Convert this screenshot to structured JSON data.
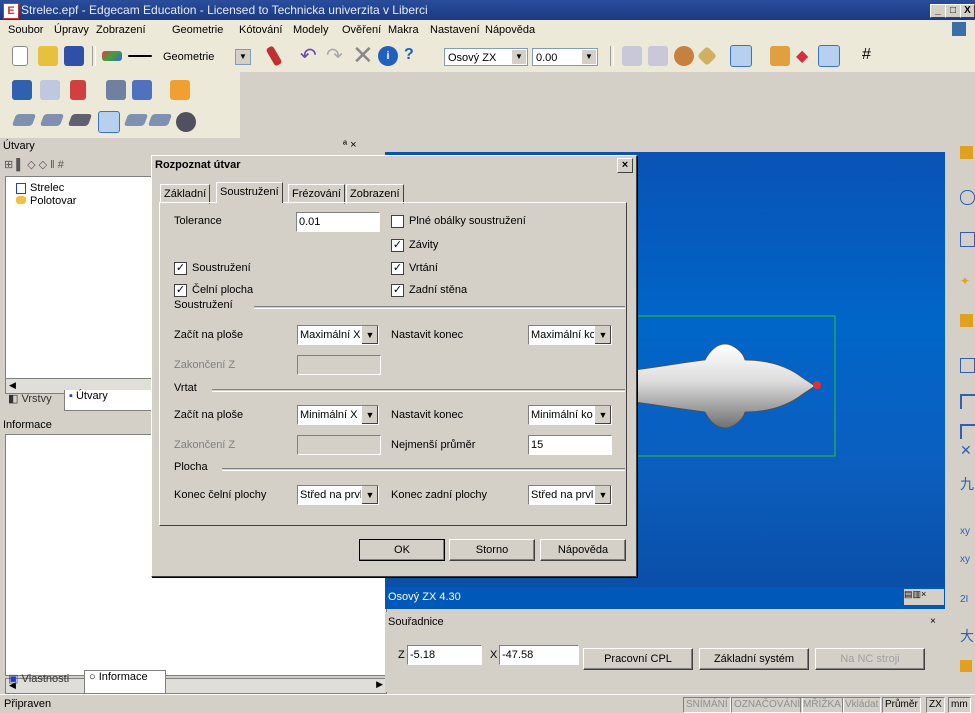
{
  "window": {
    "title": "Strelec.epf - Edgecam Education - Licensed to Technicka univerzita v Liberci",
    "icon_letter": "E",
    "min": "_",
    "restore": "□",
    "close": "X"
  },
  "menu": [
    "Soubor",
    "Úpravy",
    "Zobrazení",
    "Geometrie",
    "Kótování",
    "Modely",
    "Ověření",
    "Makra",
    "Nastavení",
    "Nápověda"
  ],
  "toolbar": {
    "geometry_label": "Geometrie",
    "cpl_value": "Osový ZX",
    "depth_value": "0.00"
  },
  "left_panel": {
    "title": "Útvary",
    "pin": "ª ×",
    "tree": [
      "Strelec",
      "Polotovar"
    ],
    "tabs": [
      "Vrstvy",
      "Útvary"
    ]
  },
  "info_panel": {
    "title": "Informace",
    "tabs": [
      "Vlastnosti",
      "Informace"
    ]
  },
  "viewport": {
    "footer_label": "Osový ZX 4.30"
  },
  "coords": {
    "title": "Souřadnice",
    "z_label": "Z",
    "z_value": "-5.18",
    "x_label": "X",
    "x_value": "-47.58",
    "btn_cpl": "Pracovní CPL",
    "btn_base": "Základní systém",
    "btn_nc": "Na NC stroji"
  },
  "dialog": {
    "title": "Rozpoznat útvar",
    "close": "×",
    "tabs": [
      "Základní",
      "Soustružení",
      "Frézování",
      "Zobrazení"
    ],
    "tolerance_label": "Tolerance",
    "tolerance_value": "0.01",
    "checks": {
      "plne": "Plné obálky soustružení",
      "zavity": "Závity",
      "soustruzeni": "Soustružení",
      "vrtani": "Vrtání",
      "celni": "Čelní plocha",
      "zadni": "Zadní stěna"
    },
    "group_soustruzeni": "Soustružení",
    "group_vrtat": "Vrtat",
    "group_plocha": "Plocha",
    "zacit_label": "Začít na ploše",
    "nastavit_label": "Nastavit konec",
    "zakonceni_label": "Zakončení Z",
    "nejmensi_label": "Nejmenší průměr",
    "nejmensi_value": "15",
    "konec_celni_label": "Konec čelní plochy",
    "konec_zadni_label": "Konec zadní plochy",
    "sel_s_zacit": "Maximální X",
    "sel_s_konec": "Maximální ko",
    "sel_v_zacit": "Minimální X",
    "sel_v_konec": "Minimální ko",
    "sel_p_celni": "Střed na prvl",
    "sel_p_zadni": "Střed na prvl",
    "ok": "OK",
    "storno": "Storno",
    "help": "Nápověda"
  },
  "status": {
    "left": "Připraven",
    "items": [
      "SNÍMÁNÍ",
      "OZNAČOVÁNÍ",
      "MŘÍŽKA",
      "Vkládat",
      "Průměr",
      "ZX",
      "mm"
    ]
  },
  "colors": {
    "titlebar": "#1b3a80",
    "viewport": "#0066c8",
    "part": "#c8c8c8"
  }
}
